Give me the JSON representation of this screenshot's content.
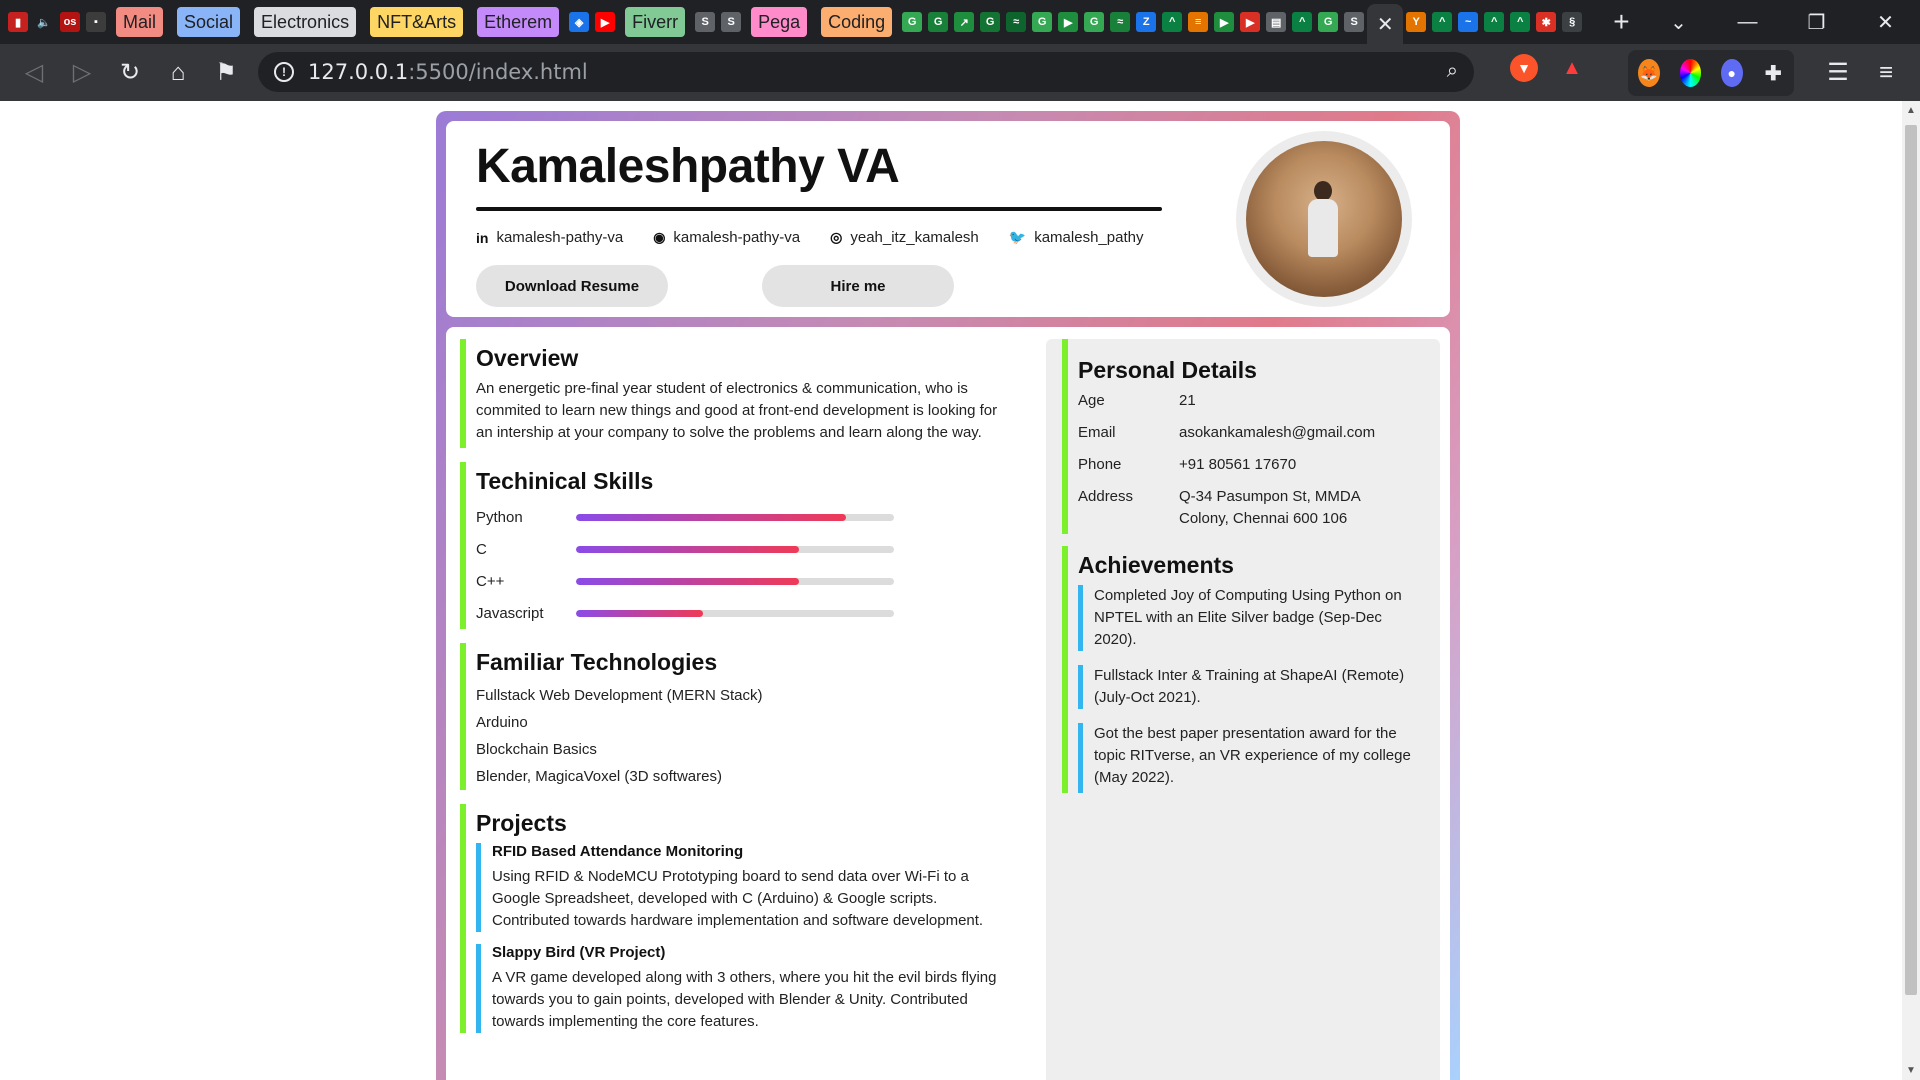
{
  "browser": {
    "tab_groups": [
      {
        "label": "Mail",
        "color": "#f28b82"
      },
      {
        "label": "Social",
        "color": "#8ab4f8"
      },
      {
        "label": "Electronics",
        "color": "#dadce0"
      },
      {
        "label": "NFT&Arts",
        "color": "#fdd663"
      },
      {
        "label": "Etherem",
        "color": "#c58af9"
      },
      {
        "label": "Fiverr",
        "color": "#81c995"
      },
      {
        "label": "Pega",
        "color": "#ff8bcb"
      },
      {
        "label": "Coding",
        "color": "#fcad70"
      }
    ],
    "url_host": "127.0.0.1",
    "url_rest": ":5500/index.html"
  },
  "profile": {
    "name": "Kamaleshpathy VA",
    "socials": [
      {
        "icon": "linkedin-icon",
        "glyph": "in",
        "handle": "kamalesh-pathy-va"
      },
      {
        "icon": "github-icon",
        "glyph": "◉",
        "handle": "kamalesh-pathy-va"
      },
      {
        "icon": "instagram-icon",
        "glyph": "◎",
        "handle": "yeah_itz_kamalesh"
      },
      {
        "icon": "twitter-icon",
        "glyph": "🐦",
        "handle": "kamalesh_pathy"
      }
    ],
    "download_label": "Download Resume",
    "hire_label": "Hire me"
  },
  "overview": {
    "title": "Overview",
    "text": "An energetic pre-final year student of electronics & communication, who is commited to learn new things and good at front-end development is looking for an intership at your company to solve the problems and learn along the way."
  },
  "skills": {
    "title": "Techinical Skills",
    "items": [
      {
        "name": "Python",
        "level": 0.85
      },
      {
        "name": "C",
        "level": 0.7
      },
      {
        "name": "C++",
        "level": 0.7
      },
      {
        "name": "Javascript",
        "level": 0.4
      }
    ],
    "colors": {
      "start": "#8a4be8",
      "end": "#ef3a56",
      "track": "#dcdcdc"
    }
  },
  "technologies": {
    "title": "Familiar Technologies",
    "items": [
      "Fullstack Web Development (MERN Stack)",
      "Arduino",
      "Blockchain Basics",
      "Blender, MagicaVoxel (3D softwares)"
    ]
  },
  "projects": {
    "title": "Projects",
    "items": [
      {
        "name": "RFID Based Attendance Monitoring",
        "desc": "Using RFID & NodeMCU Prototyping board to send data over Wi-Fi to a Google Spreadsheet, developed with C (Arduino) & Google scripts. Contributed towards hardware implementation and software development."
      },
      {
        "name": "Slappy Bird (VR Project)",
        "desc": "A VR game developed along with 3 others, where you hit the evil birds flying towards you to gain points, developed with Blender & Unity. Contributed towards implementing the core features."
      }
    ]
  },
  "personal": {
    "title": "Personal Details",
    "rows": [
      {
        "label": "Age",
        "value": "21"
      },
      {
        "label": "Email",
        "value": "asokankamalesh@gmail.com"
      },
      {
        "label": "Phone",
        "value": "+91 80561 17670"
      },
      {
        "label": "Address",
        "value": "Q-34 Pasumpon St, MMDA Colony, Chennai 600 106"
      }
    ]
  },
  "achievements": {
    "title": "Achievements",
    "items": [
      "Completed Joy of Computing Using Python on NPTEL with an Elite Silver badge (Sep-Dec 2020).",
      "Fullstack Inter & Training at ShapeAI (Remote) (July-Oct 2021).",
      "Got the best paper presentation award for the topic RITverse, an VR experience of my college (May 2022)."
    ]
  },
  "colors": {
    "accent_green": "#7cf02a",
    "accent_blue": "#33b6f0"
  }
}
